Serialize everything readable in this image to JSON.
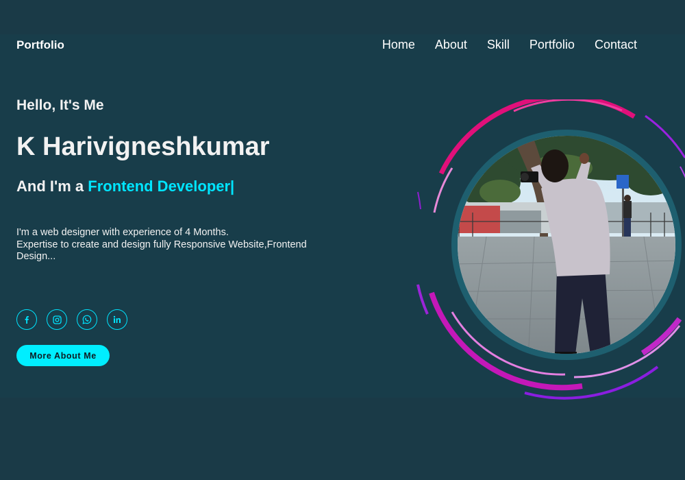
{
  "header": {
    "brand": "Portfolio",
    "nav": [
      {
        "label": "Home"
      },
      {
        "label": "About"
      },
      {
        "label": "Skill"
      },
      {
        "label": "Portfolio"
      },
      {
        "label": "Contact"
      }
    ]
  },
  "hero": {
    "greeting": "Hello, It's Me",
    "name": "K Harivigneshkumar",
    "role_prefix": "And I'm a ",
    "role_highlight": "Frontend Developer|",
    "bio_line1": "I'm a web designer with experience of 4 Months.",
    "bio_line2": "Expertise to create and design fully Responsive Website,Frontend Design...",
    "cta_label": "More About Me"
  },
  "socials": [
    {
      "icon": "facebook-icon"
    },
    {
      "icon": "instagram-icon"
    },
    {
      "icon": "whatsapp-icon"
    },
    {
      "icon": "linkedin-icon"
    }
  ],
  "colors": {
    "background": "#183d4a",
    "accent": "#00e5ff",
    "ring_pink": "#e0107a",
    "ring_purple": "#a01fd6",
    "photo_ring": "#1e5f6f"
  }
}
